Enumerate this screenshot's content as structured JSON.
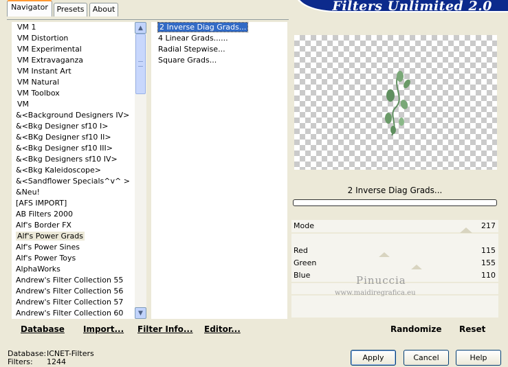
{
  "header": {
    "logo_text": "Filters Unlimited 2.0"
  },
  "tabs": [
    {
      "label": "Navigator",
      "active": true
    },
    {
      "label": "Presets",
      "active": false
    },
    {
      "label": "About",
      "active": false
    }
  ],
  "categories": [
    "VM 1",
    "VM Distortion",
    "VM Experimental",
    "VM Extravaganza",
    "VM Instant Art",
    "VM Natural",
    "VM Toolbox",
    "VM",
    "&<Background Designers IV>",
    "&<Bkg Designer sf10 I>",
    "&<BKg Designer sf10 II>",
    "&<Bkg Designer sf10 III>",
    "&<Bkg Designers sf10 IV>",
    "&<Bkg Kaleidoscope>",
    "&<Sandflower Specials^v^ >",
    "&Neu!",
    "[AFS IMPORT]",
    "AB Filters 2000",
    "Alf's Border FX",
    "Alf's Power Grads",
    "Alf's Power Sines",
    "Alf's Power Toys",
    "AlphaWorks",
    "Andrew's Filter Collection 55",
    "Andrew's Filter Collection 56",
    "Andrew's Filter Collection 57",
    "Andrew's Filter Collection 60"
  ],
  "selected_category": "Alf's Power Grads",
  "filters": [
    "2 Inverse Diag Grads...",
    "4 Linear Grads......",
    "Radial Stepwise...",
    "Square Grads..."
  ],
  "selected_filter": "2 Inverse Diag Grads...",
  "left_buttons": {
    "database": "Database",
    "import": "Import...",
    "filter_info": "Filter Info...",
    "editor": "Editor..."
  },
  "preview": {
    "filter_name": "2 Inverse Diag Grads..."
  },
  "params": [
    {
      "label": "Mode",
      "value": "217"
    },
    {
      "label": "Red",
      "value": "115"
    },
    {
      "label": "Green",
      "value": "155"
    },
    {
      "label": "Blue",
      "value": "110"
    }
  ],
  "right_buttons": {
    "randomize": "Randomize",
    "reset": "Reset"
  },
  "watermark": {
    "name": "Pinuccia",
    "url": "www.maidiregrafica.eu"
  },
  "status": {
    "database_label": "Database:",
    "database_value": "ICNET-Filters",
    "filters_label": "Filters:",
    "filters_value": "1244"
  },
  "footer_buttons": {
    "apply": "Apply",
    "cancel": "Cancel",
    "help": "Help"
  }
}
